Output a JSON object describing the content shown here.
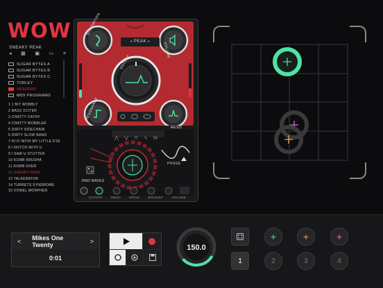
{
  "app": {
    "logo": "WOW"
  },
  "browser": {
    "current_preset": "SNEAKY PEAK",
    "toolbar_icons": [
      "speaker-icon",
      "grid-icon",
      "save-icon",
      "folder-icon",
      "list-icon"
    ],
    "folders": [
      {
        "label": "SUGAR BYTES A",
        "selected": false
      },
      {
        "label": "SUGAR BYTES B",
        "selected": false
      },
      {
        "label": "SUGAR BYTES C",
        "selected": false
      },
      {
        "label": "TORLEY",
        "selected": false
      },
      {
        "label": "VESPERS",
        "selected": true
      },
      {
        "label": "MIDI PROGRAMS",
        "selected": false
      }
    ],
    "presets": [
      {
        "label": "1  1 BIT WOBBLY",
        "selected": false
      },
      {
        "label": "2  BASS XCITER",
        "selected": false
      },
      {
        "label": "3  CHATTY CATHY",
        "selected": false
      },
      {
        "label": "4  CHATTY WOBBLER",
        "selected": false
      },
      {
        "label": "5  DIRTY SIDECHAIN",
        "selected": false
      },
      {
        "label": "6  DIRTY SLOW BAND",
        "selected": false
      },
      {
        "label": "7  HI FI WITH MY LITTLE EYE",
        "selected": false
      },
      {
        "label": "8  I NOTCH WITH U",
        "selected": false
      },
      {
        "label": "9  I SAW U STUTTER",
        "selected": false
      },
      {
        "label": "10 KOMB KRUSHA",
        "selected": false
      },
      {
        "label": "11 KOMB OVER",
        "selected": false
      },
      {
        "label": "12 SNEAKY PEAK",
        "selected": true
      },
      {
        "label": "13 TALKERATOR",
        "selected": false
      },
      {
        "label": "14 TURRETS SYNDROME",
        "selected": false
      },
      {
        "label": "15 VOWEL MORPHER",
        "selected": false
      }
    ]
  },
  "device": {
    "filter_type": "PEAK",
    "knobs": {
      "distortion": "DISTORTION",
      "volume": "VOLUME",
      "cutoff": "CUTOFF",
      "resonance": "RESONANCE",
      "reso": "RESO"
    },
    "phase_label": "PHASE",
    "rnd_waves_label": "RND WAVES",
    "mod_targets": [
      "CUTOFF",
      "RESO",
      "DRIVE",
      "ENVINST",
      "VOLUME"
    ]
  },
  "xy_pad": {
    "cursor_colors": [
      "#4ee3a6",
      "#e46bd8",
      "#f0a25c"
    ]
  },
  "transport": {
    "song_title": "Mikes One Twenty",
    "time": "0:01",
    "bpm": "150.0",
    "bpm_progress": 0.3,
    "snapshot_numbers": [
      "1",
      "2",
      "3",
      "4"
    ],
    "snapshot_colors": [
      "#4ee3a6",
      "#f0a25c",
      "#e46bd8"
    ],
    "record_color": "#e0353f",
    "accent": "#4ee3a6"
  }
}
